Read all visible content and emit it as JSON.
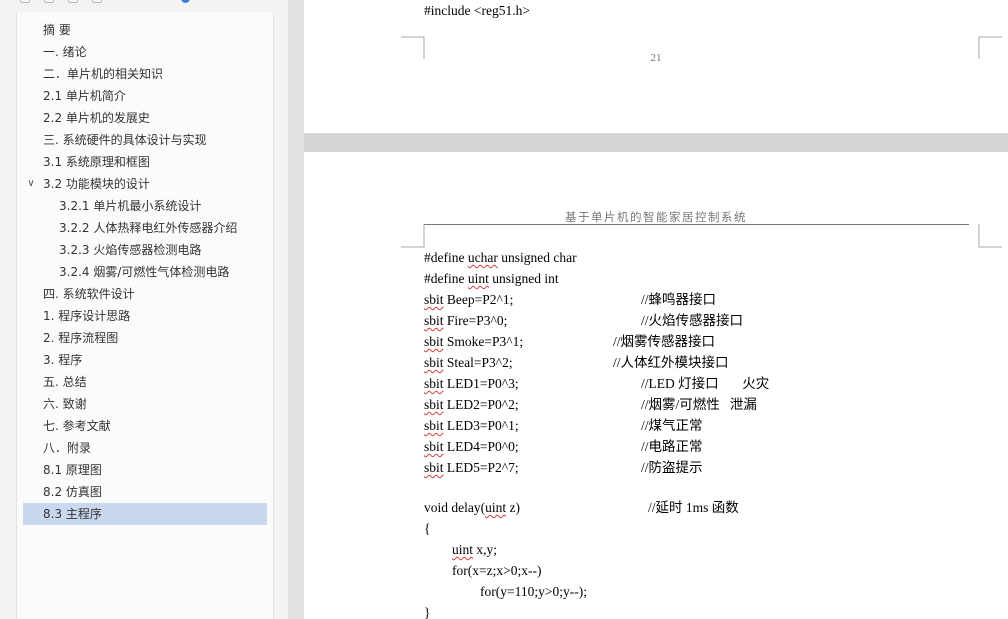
{
  "nav": {
    "items": [
      {
        "label": "摘 要"
      },
      {
        "label": "一. 绪论"
      },
      {
        "label": "二．单片机的相关知识"
      },
      {
        "label": "2.1 单片机简介"
      },
      {
        "label": "2.2 单片机的发展史"
      },
      {
        "label": "三. 系统硬件的具体设计与实现"
      },
      {
        "label": "3.1  系统原理和框图"
      },
      {
        "label": "3.2  功能模块的设计",
        "expanded": true
      },
      {
        "label": "3.2.1 单片机最小系统设计"
      },
      {
        "label": "3.2.2  人体热释电红外传感器介绍"
      },
      {
        "label": "3.2.3 火焰传感器检测电路"
      },
      {
        "label": "3.2.4 烟雾/可燃性气体检测电路"
      },
      {
        "label": "四. 系统软件设计"
      },
      {
        "label": "1. 程序设计思路"
      },
      {
        "label": "2. 程序流程图"
      },
      {
        "label": "3. 程序"
      },
      {
        "label": "五. 总结"
      },
      {
        "label": "六. 致谢"
      },
      {
        "label": "七. 参考文献"
      },
      {
        "label": "八．附录"
      },
      {
        "label": "8.1 原理图"
      },
      {
        "label": "8.2 仿真图"
      },
      {
        "label": "8.3 主程序",
        "selected": true
      }
    ],
    "expand_icon": "chevron-down-icon"
  },
  "page1": {
    "code_line": "#include <reg51.h>",
    "page_number": "21"
  },
  "page2": {
    "header": "基于单片机的智能家居控制系统",
    "code": [
      {
        "pre": "#define ",
        "kw": "uchar",
        "post": " unsigned char",
        "comment": ""
      },
      {
        "pre": "#define ",
        "kw": "uint",
        "post": " unsigned int",
        "comment": ""
      },
      {
        "pre": "",
        "kw": "sbit",
        "post": " Beep=P2^1;",
        "comment": "//蜂鸣器接口"
      },
      {
        "pre": "",
        "kw": "sbit",
        "post": " Fire=P3^0;",
        "comment": "//火焰传感器接口"
      },
      {
        "pre": "",
        "kw": "sbit",
        "post": " Smoke=P3^1;",
        "comment": "//烟雾传感器接口"
      },
      {
        "pre": "",
        "kw": "sbit",
        "post": " Steal=P3^2;",
        "comment": "//人体红外模块接口"
      },
      {
        "pre": "",
        "kw": "sbit",
        "post": " LED1=P0^3;",
        "comment": "//LED 灯接口       火灾"
      },
      {
        "pre": "",
        "kw": "sbit",
        "post": " LED2=P0^2;",
        "comment": "//烟雾/可燃性   泄漏"
      },
      {
        "pre": "",
        "kw": "sbit",
        "post": " LED3=P0^1;",
        "comment": "//煤气正常"
      },
      {
        "pre": "",
        "kw": "sbit",
        "post": " LED4=P0^0;",
        "comment": "//电路正常"
      },
      {
        "pre": "",
        "kw": "sbit",
        "post": " LED5=P2^7;",
        "comment": "//防盗提示"
      },
      {
        "pre": "",
        "kw": "",
        "post": "",
        "comment": ""
      },
      {
        "pre": "void delay(",
        "kw": "uint",
        "post": " z)",
        "comment": "//延时 1ms 函数"
      },
      {
        "pre": "{",
        "kw": "",
        "post": "",
        "comment": ""
      },
      {
        "pre": "",
        "kw": "uint",
        "post": " x,y;",
        "comment": ""
      },
      {
        "pre": "for(x=z;x>0;x--)",
        "kw": "",
        "post": "",
        "comment": ""
      },
      {
        "pre": "for(y=110;y>0;y--);",
        "kw": "",
        "post": "",
        "comment": ""
      },
      {
        "pre": "}",
        "kw": "",
        "post": "",
        "comment": ""
      }
    ]
  }
}
